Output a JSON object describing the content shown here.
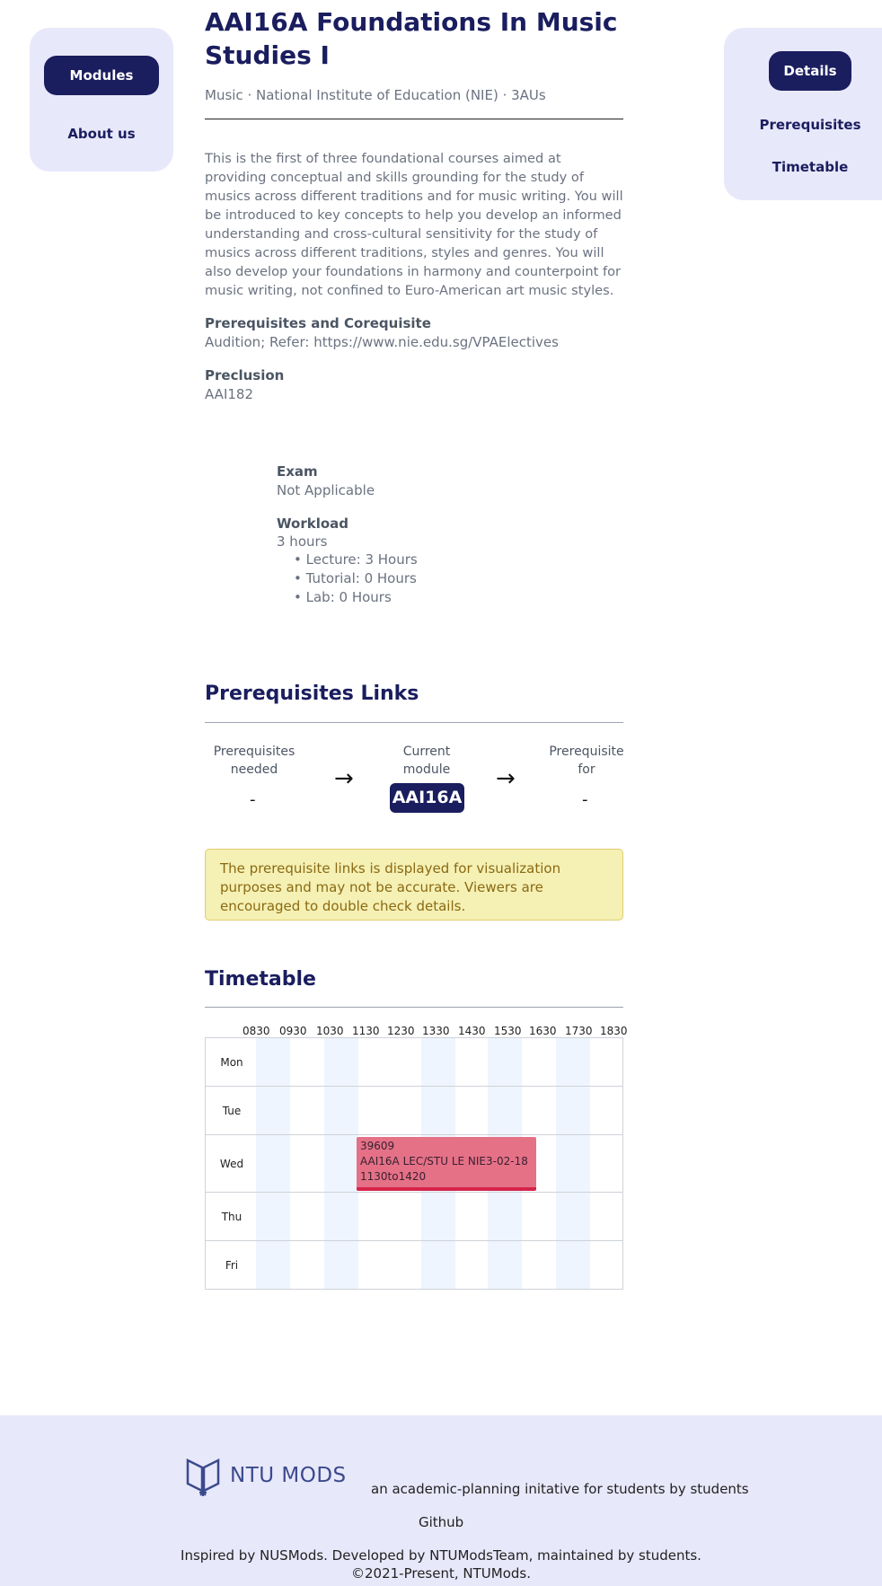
{
  "left_nav": {
    "modules_label": "Modules",
    "about_label": "About us"
  },
  "right_nav": {
    "details_label": "Details",
    "prereq_label": "Prerequisites",
    "timetable_label": "Timetable"
  },
  "module": {
    "title": "AAI16A Foundations In Music Studies I",
    "subtitle": "Music · National Institute of Education (NIE) · 3AUs",
    "description": "This is the first of three foundational courses aimed at providing conceptual and skills grounding for the study of musics across different traditions and for music writing. You will be introduced to key concepts to help you develop an informed understanding and cross-cultural sensitivity for the study of musics across different traditions, styles and genres. You will also develop your foundations in harmony and counterpoint for music writing, not confined to Euro-American art music styles.",
    "prereq_heading": "Prerequisites and Corequisite",
    "prereq_value": "Audition; Refer: https://www.nie.edu.sg/VPAElectives",
    "preclusion_heading": "Preclusion",
    "preclusion_value": "AAI182",
    "exam_heading": "Exam",
    "exam_value": "Not Applicable",
    "workload_heading": "Workload",
    "workload_value": "3 hours",
    "workload_items": [
      "Lecture: 3 Hours",
      "Tutorial: 0 Hours",
      "Lab: 0 Hours"
    ]
  },
  "prereq_links": {
    "heading": "Prerequisites Links",
    "needed_label_1": "Prerequisites",
    "needed_label_2": "needed",
    "needed_value": "-",
    "current_label_1": "Current",
    "current_label_2": "module",
    "current_code": "AAI16A",
    "for_label_1": "Prerequisite",
    "for_label_2": "for",
    "for_value": "-",
    "arrow": "→",
    "warning": "The prerequisite links is displayed for visualization purposes and may not be accurate. Viewers are encouraged to double check details."
  },
  "timetable": {
    "heading": "Timetable",
    "hours": [
      "0830",
      "0930",
      "1030",
      "1130",
      "1230",
      "1330",
      "1430",
      "1530",
      "1630",
      "1730",
      "1830"
    ],
    "days": [
      "Mon",
      "Tue",
      "Wed",
      "Thu",
      "Fri"
    ],
    "event": {
      "index": "39609",
      "description": "AAI16A LEC/STU LE NIE3-02-18",
      "time": "1130to1420",
      "day": "Wed",
      "start": "1130",
      "end": "1420"
    }
  },
  "footer": {
    "logo_text": "NTU MODS",
    "tagline": "an academic-planning initative for students by students",
    "github": "Github",
    "credits": "Inspired by NUSMods. Developed by NTUModsTeam, maintained by students.",
    "copyright": "©2021-Present, NTUMods."
  }
}
